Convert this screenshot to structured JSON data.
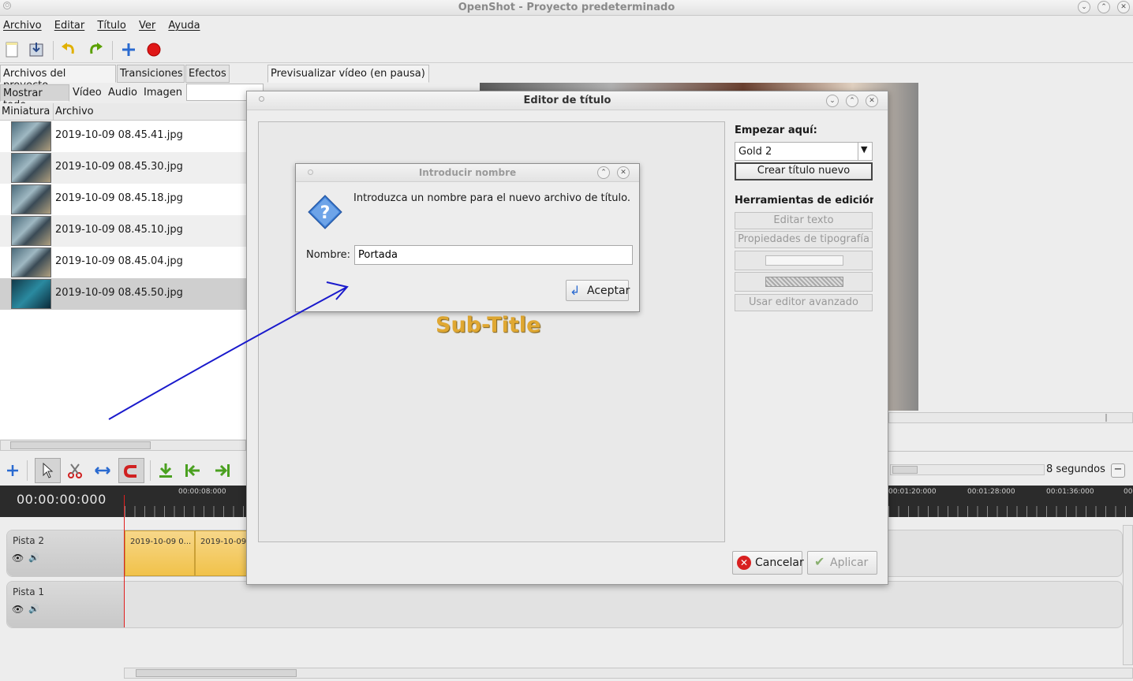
{
  "window": {
    "title": "OpenShot - Proyecto predeterminado"
  },
  "menu": [
    "Archivo",
    "Editar",
    "Título",
    "Ver",
    "Ayuda"
  ],
  "left_tabs": [
    "Archivos del proyecto",
    "Transiciones",
    "Efectos"
  ],
  "filter_tabs": [
    "Mostrar todo",
    "Vídeo",
    "Audio",
    "Imagen"
  ],
  "columns": [
    "Miniatura",
    "Archivo"
  ],
  "files": [
    "2019-10-09 08.45.41.jpg",
    "2019-10-09 08.45.30.jpg",
    "2019-10-09 08.45.18.jpg",
    "2019-10-09 08.45.10.jpg",
    "2019-10-09 08.45.04.jpg",
    "2019-10-09 08.45.50.jpg"
  ],
  "preview_tab": "Previsualizar vídeo (en pausa)",
  "timeline": {
    "timecode": "00:00:00:000",
    "zoom_label": "8 segundos",
    "ticks": [
      "00:00:08:000",
      "00:01:20:000",
      "00:01:28:000",
      "00:01:36:000",
      "00"
    ],
    "tracks": [
      {
        "name": "Pista 2",
        "clips": [
          "2019-10-09 0...",
          "2019-10-09"
        ]
      },
      {
        "name": "Pista 1",
        "clips": []
      }
    ]
  },
  "title_editor": {
    "title": "Editor de título",
    "start_label": "Empezar aquí:",
    "template_value": "Gold 2",
    "create_button": "Crear título nuevo",
    "tools_label": "Herramientas de edición",
    "edit_text": "Editar texto",
    "font_props": "Propiedades de tipografía",
    "advanced": "Usar editor avanzado",
    "cancel": "Cancelar",
    "apply": "Aplicar",
    "preview_subtitle": "Sub-Title"
  },
  "name_dialog": {
    "title": "Introducir nombre",
    "message": "Introduzca un nombre para el nuevo archivo de título.",
    "label": "Nombre:",
    "value": "Portada",
    "accept": "Aceptar"
  },
  "colors": {
    "accent_gold": "#e0a832",
    "timeline_bg": "#2b2b2b",
    "playhead": "#e02020",
    "annotation_arrow": "#1a1acc"
  }
}
